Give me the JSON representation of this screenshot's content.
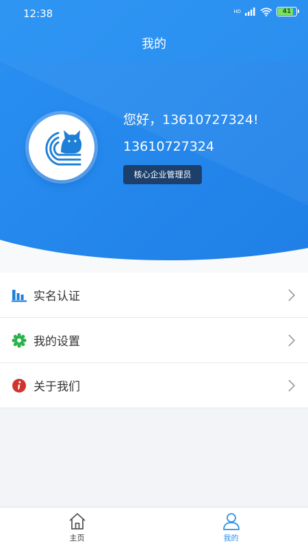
{
  "status_bar": {
    "time": "12:38",
    "network": "HD",
    "battery": "41"
  },
  "header": {
    "title": "我的"
  },
  "profile": {
    "greeting": "您好，13610727324!",
    "phone": "13610727324",
    "role": "核心企业管理员",
    "avatar_icon": "cat-logo-icon"
  },
  "menu": {
    "items": [
      {
        "label": "实名认证",
        "icon": "bar-chart-icon",
        "icon_color": "#1e7fd8"
      },
      {
        "label": "我的设置",
        "icon": "gear-icon",
        "icon_color": "#2ab34a"
      },
      {
        "label": "关于我们",
        "icon": "info-icon",
        "icon_color": "#d2332e"
      }
    ]
  },
  "tabbar": {
    "tabs": [
      {
        "label": "主页",
        "icon": "home-icon",
        "active": false
      },
      {
        "label": "我的",
        "icon": "user-icon",
        "active": true
      }
    ]
  },
  "colors": {
    "accent": "#2b90ea",
    "header_top": "#1f8af0",
    "badge_bg": "#1c3f6b"
  }
}
